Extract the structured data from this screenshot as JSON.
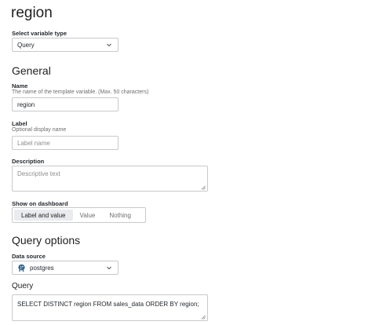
{
  "page": {
    "title": "region"
  },
  "variable_type": {
    "label": "Select variable type",
    "value": "Query"
  },
  "general": {
    "title": "General",
    "name": {
      "label": "Name",
      "description": "The name of the template variable. (Max. 50 characters)",
      "value": "region"
    },
    "label_field": {
      "label": "Label",
      "description": "Optional display name",
      "placeholder": "Label name"
    },
    "description_field": {
      "label": "Description",
      "placeholder": "Descriptive text"
    },
    "show_on_dashboard": {
      "label": "Show on dashboard",
      "options": [
        "Label and value",
        "Value",
        "Nothing"
      ],
      "selected": "Label and value"
    }
  },
  "query_options": {
    "title": "Query options",
    "data_source": {
      "label": "Data source",
      "value": "postgres",
      "icon": "postgres-elephant-icon"
    },
    "query": {
      "label": "Query",
      "value": "SELECT DISTINCT region FROM sales_data ORDER BY region;"
    }
  },
  "colors": {
    "border": "#c7c9cc",
    "selected_option_bg": "#e9ebee",
    "postgres_blue": "#336791"
  }
}
